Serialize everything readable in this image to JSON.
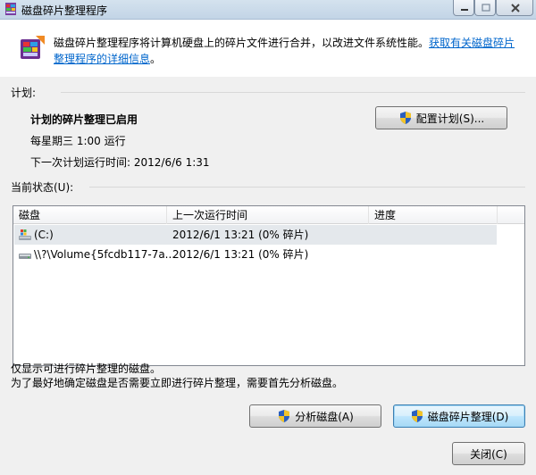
{
  "window": {
    "title": "磁盘碎片整理程序"
  },
  "header": {
    "description": "磁盘碎片整理程序将计算机硬盘上的碎片文件进行合并，以改进文件系统性能。",
    "link_text": "获取有关磁盘碎片整理程序的详细信息",
    "link_suffix": "。"
  },
  "schedule": {
    "section_label": "计划:",
    "status": "计划的碎片整理已启用",
    "frequency": "每星期三  1:00 运行",
    "next_run": "下一次计划运行时间: 2012/6/6 1:31",
    "configure_button": "配置计划(S)..."
  },
  "current_status": {
    "section_label": "当前状态(U):",
    "columns": [
      "磁盘",
      "上一次运行时间",
      "进度"
    ],
    "rows": [
      {
        "disk": "(C:)",
        "last_run": "2012/6/1 13:21 (0% 碎片)",
        "progress": "",
        "icon": "system-drive-icon"
      },
      {
        "disk": "\\\\?\\Volume{5fcdb117-7a...",
        "last_run": "2012/6/1 13:21 (0% 碎片)",
        "progress": "",
        "icon": "hard-drive-icon"
      }
    ]
  },
  "notes": {
    "line1": "仅显示可进行碎片整理的磁盘。",
    "line2": "为了最好地确定磁盘是否需要立即进行碎片整理，需要首先分析磁盘。"
  },
  "buttons": {
    "analyze": "分析磁盘(A)",
    "defragment": "磁盘碎片整理(D)",
    "close": "关闭(C)"
  },
  "colors": {
    "link": "#0066cc",
    "default_button_border": "#3c7fb1"
  }
}
